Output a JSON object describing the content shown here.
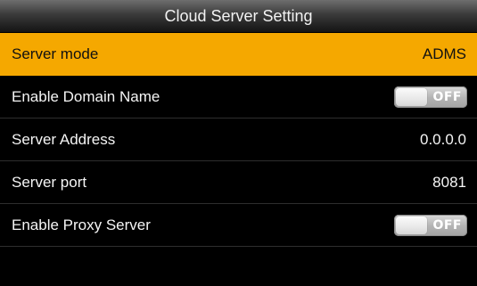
{
  "title": "Cloud Server Setting",
  "accent_color": "#f5a800",
  "rows": [
    {
      "label": "Server mode",
      "value": "ADMS",
      "type": "value",
      "selected": true
    },
    {
      "label": "Enable Domain Name",
      "value": "OFF",
      "type": "toggle",
      "selected": false
    },
    {
      "label": "Server Address",
      "value": "0.0.0.0",
      "type": "value",
      "selected": false
    },
    {
      "label": "Server port",
      "value": "8081",
      "type": "value",
      "selected": false
    },
    {
      "label": "Enable Proxy Server",
      "value": "OFF",
      "type": "toggle",
      "selected": false
    }
  ]
}
